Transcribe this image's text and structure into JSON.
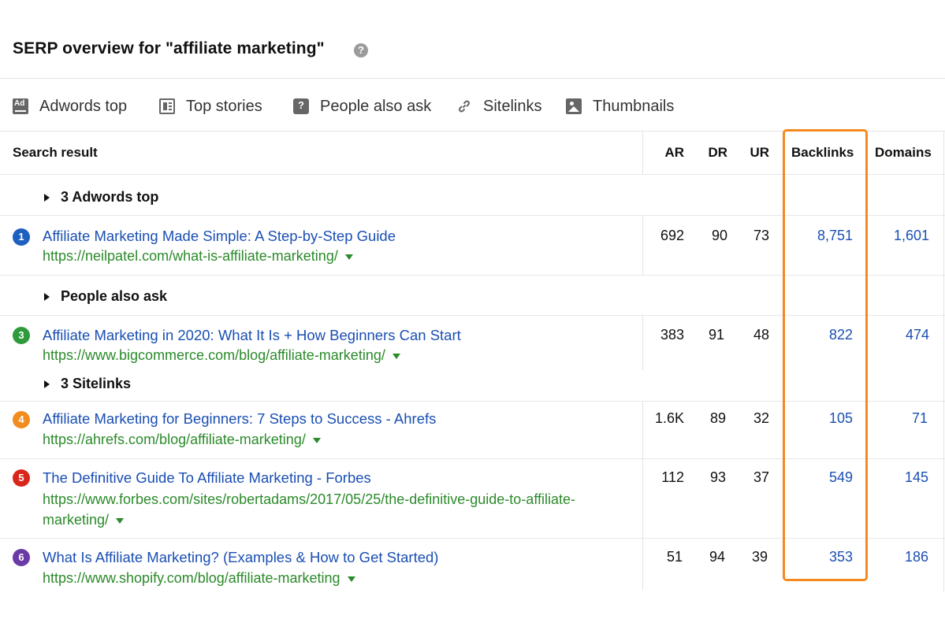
{
  "header": {
    "title": "SERP overview for \"affiliate marketing\"",
    "help_icon": "?"
  },
  "features": [
    {
      "icon": "ad-icon",
      "label": "Adwords top"
    },
    {
      "icon": "stories-icon",
      "label": "Top stories"
    },
    {
      "icon": "question-icon",
      "label": "People also ask"
    },
    {
      "icon": "link-icon",
      "label": "Sitelinks"
    },
    {
      "icon": "image-icon",
      "label": "Thumbnails"
    }
  ],
  "table": {
    "columns": {
      "result": "Search result",
      "ar": "AR",
      "dr": "DR",
      "ur": "UR",
      "backlinks": "Backlinks",
      "domains": "Domains"
    },
    "groups": {
      "adwords": "3 Adwords top",
      "paa": "People also ask",
      "sitelinks": "3 Sitelinks"
    },
    "rows": [
      {
        "rank": "1",
        "rank_color": "#1f5fbf",
        "title": "Affiliate Marketing Made Simple: A Step-by-Step Guide",
        "url": "https://neilpatel.com/what-is-affiliate-marketing/",
        "ar": "692",
        "dr": "90",
        "ur": "73",
        "backlinks": "8,751",
        "domains": "1,601"
      },
      {
        "rank": "3",
        "rank_color": "#2e9a3b",
        "title": "Affiliate Marketing in 2020: What It Is + How Beginners Can Start",
        "url": "https://www.bigcommerce.com/blog/affiliate-marketing/",
        "ar": "383",
        "dr": "91",
        "ur": "48",
        "backlinks": "822",
        "domains": "474"
      },
      {
        "rank": "4",
        "rank_color": "#f28c1e",
        "title": "Affiliate Marketing for Beginners: 7 Steps to Success - Ahrefs",
        "url": "https://ahrefs.com/blog/affiliate-marketing/",
        "ar": "1.6K",
        "dr": "89",
        "ur": "32",
        "backlinks": "105",
        "domains": "71"
      },
      {
        "rank": "5",
        "rank_color": "#d9261c",
        "title": "The Definitive Guide To Affiliate Marketing - Forbes",
        "url_line1": "https://www.forbes.com/sites/robertadams/2017/05/25/the-definitive-guide-to-affiliate-",
        "url_line2": "marketing/",
        "ar": "112",
        "dr": "93",
        "ur": "37",
        "backlinks": "549",
        "domains": "145"
      },
      {
        "rank": "6",
        "rank_color": "#6a3aa6",
        "title": "What Is Affiliate Marketing? (Examples & How to Get Started)",
        "url": "https://www.shopify.com/blog/affiliate-marketing",
        "ar": "51",
        "dr": "94",
        "ur": "39",
        "backlinks": "353",
        "domains": "186"
      }
    ]
  }
}
